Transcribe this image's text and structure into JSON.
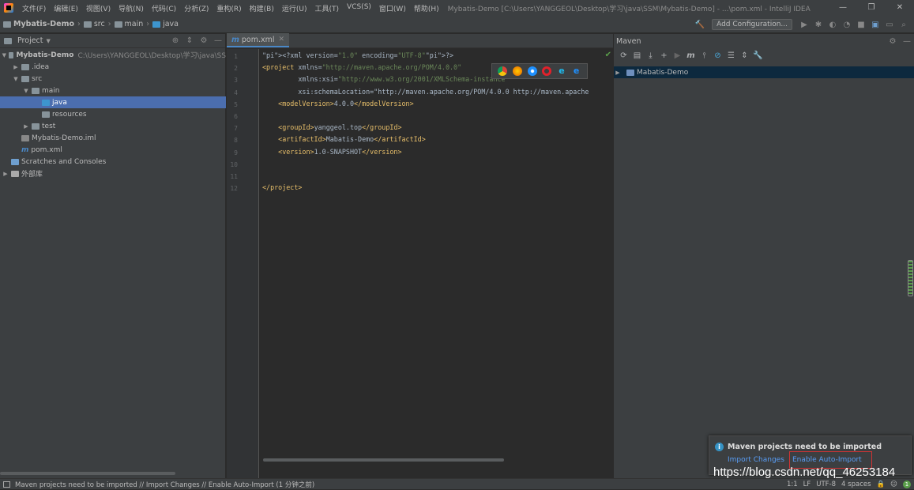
{
  "menubar": {
    "items": [
      "文件(F)",
      "编辑(E)",
      "视图(V)",
      "导航(N)",
      "代码(C)",
      "分析(Z)",
      "重构(R)",
      "构建(B)",
      "运行(U)",
      "工具(T)",
      "VCS(S)",
      "窗口(W)",
      "帮助(H)"
    ],
    "window_title": "Mybatis-Demo [C:\\Users\\YANGGEOL\\Desktop\\学习\\java\\SSM\\Mybatis-Demo] - ...\\pom.xml - IntelliJ IDEA"
  },
  "navbar": {
    "crumbs": [
      "Mybatis-Demo",
      "src",
      "main",
      "java"
    ],
    "add_configuration": "Add Configuration..."
  },
  "project_panel": {
    "title": "Project",
    "tree": [
      {
        "label": "Mybatis-Demo",
        "hint": "C:\\Users\\YANGGEOL\\Desktop\\学习\\java\\SS",
        "icon": "folder-icon",
        "arrow": "▼",
        "bold": true
      },
      {
        "label": ".idea",
        "icon": "folder-icon",
        "arrow": "▶"
      },
      {
        "label": "src",
        "icon": "folder-icon",
        "arrow": "▼"
      },
      {
        "label": "main",
        "icon": "folder-icon",
        "arrow": "▼"
      },
      {
        "label": "java",
        "icon": "source-folder-icon",
        "arrow": "",
        "selected": true
      },
      {
        "label": "resources",
        "icon": "resources-folder-icon",
        "arrow": ""
      },
      {
        "label": "test",
        "icon": "folder-icon",
        "arrow": "▶"
      },
      {
        "label": "Mybatis-Demo.iml",
        "icon": "iml-file-icon",
        "arrow": ""
      },
      {
        "label": "pom.xml",
        "icon": "maven-file-icon",
        "arrow": ""
      },
      {
        "label": "Scratches and Consoles",
        "icon": "scratches-icon",
        "arrow": ""
      },
      {
        "label": "外部库",
        "icon": "libraries-icon",
        "arrow": "▶"
      }
    ]
  },
  "editor": {
    "tab": "pom.xml",
    "line_numbers": [
      "1",
      "2",
      "3",
      "4",
      "5",
      "6",
      "7",
      "8",
      "9",
      "10",
      "11",
      "12"
    ],
    "code": [
      "<?xml version=\"1.0\" encoding=\"UTF-8\"?>",
      "<project xmlns=\"http://maven.apache.org/POM/4.0.0\"",
      "         xmlns:xsi=\"http://www.w3.org/2001/XMLSchema-instance\"",
      "         xsi:schemaLocation=\"http://maven.apache.org/POM/4.0.0 http://maven.apache",
      "    <modelVersion>4.0.0</modelVersion>",
      "",
      "    <groupId>yanggeol.top</groupId>",
      "    <artifactId>Mabatis-Demo</artifactId>",
      "    <version>1.0-SNAPSHOT</version>",
      "",
      "",
      "</project>"
    ],
    "browser_icons": [
      "chrome-icon",
      "firefox-icon",
      "safari-icon",
      "opera-icon",
      "ie-icon",
      "edge-icon"
    ]
  },
  "maven_panel": {
    "title": "Maven",
    "project": "Mabatis-Demo"
  },
  "notification": {
    "title": "Maven projects need to be imported",
    "import_changes": "Import Changes",
    "enable_auto_import": "Enable Auto-Import"
  },
  "statusbar": {
    "message": "Maven projects need to be imported // Import Changes // Enable Auto-Import (1 分钟之前)",
    "position": "1:1",
    "line_sep": "LF",
    "encoding": "UTF-8",
    "indent": "4 spaces"
  },
  "watermark": "https://blog.csdn.net/qq_46253184",
  "colors": {
    "selection": "#4b6eaf",
    "link": "#589df6",
    "highlight_box": "#d03434",
    "background": "#2b2b2b"
  }
}
